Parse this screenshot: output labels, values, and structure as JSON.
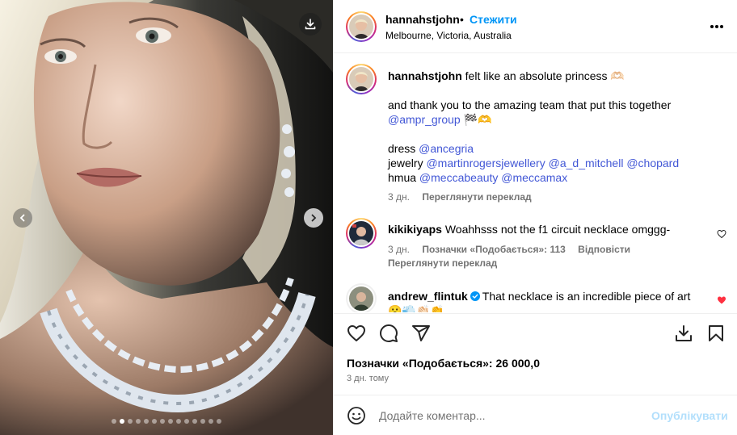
{
  "post": {
    "username": "hannahstjohn",
    "separator": "•",
    "follow_label": "Стежити",
    "location": "Melbourne, Victoria, Australia",
    "carousel": {
      "dot_count": 14,
      "active_index": 1
    }
  },
  "caption": {
    "username": "hannahstjohn",
    "line1": "felt like an absolute princess 🫶🏻",
    "line2": "and thank you to the amazing team that put this together",
    "line3_mention": "@ampr_group",
    "line3_suffix": "🏁🫶",
    "dress_label": "dress",
    "dress_mentions": [
      "@ancegria"
    ],
    "jewelry_label": "jewelry",
    "jewelry_mentions": [
      "@martinrogersjewellery",
      "@a_d_mitchell",
      "@chopard"
    ],
    "hmua_label": "hmua",
    "hmua_mentions": [
      "@meccabeauty",
      "@meccamax"
    ],
    "time": "3 дн.",
    "translate_label": "Переглянути переклад"
  },
  "comments": [
    {
      "username": "kikikiyaps",
      "text": "Woahhsss not the f1 circuit necklace omggg-",
      "time": "3 дн.",
      "likes_label": "Позначки «Подобається»: 113",
      "reply_label": "Відповісти",
      "translate_label": "Переглянути переклад",
      "liked": false
    },
    {
      "username": "andrew_flintuk",
      "verified": true,
      "text": "That necklace is an incredible piece of art",
      "text2": "😮💨👏🏻👏",
      "liked": true
    }
  ],
  "footer": {
    "likes": "Позначки «Подобається»: 26 000,0",
    "time": "3 дн. тому",
    "comment_placeholder": "Додайте коментар...",
    "post_label": "Опублікувати"
  },
  "colors": {
    "accent": "#0095f6",
    "mention": "#4257d6",
    "heart": "#ff3040",
    "muted": "#737373"
  },
  "icons": [
    "download-icon",
    "chevron-left-icon",
    "chevron-right-icon",
    "more-icon",
    "heart-icon",
    "comment-icon",
    "share-icon",
    "save-icon",
    "emoji-icon",
    "verified-icon"
  ]
}
